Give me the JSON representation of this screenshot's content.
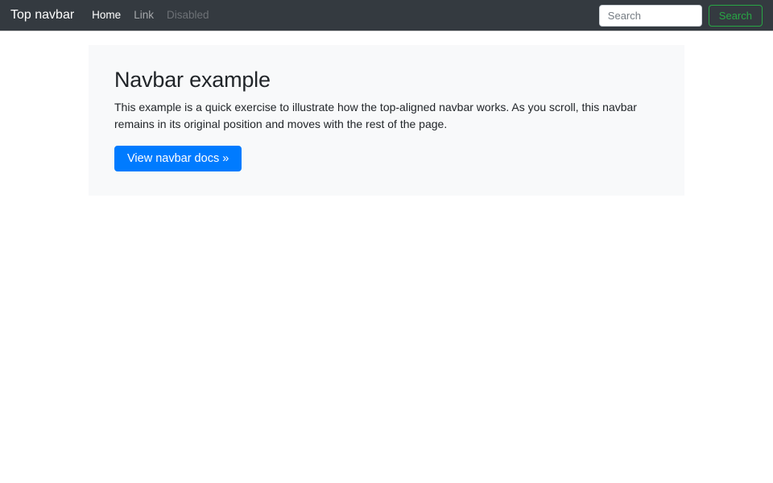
{
  "navbar": {
    "brand": "Top navbar",
    "links": [
      {
        "label": "Home",
        "state": "active"
      },
      {
        "label": "Link",
        "state": "normal"
      },
      {
        "label": "Disabled",
        "state": "disabled"
      }
    ],
    "search": {
      "placeholder": "Search",
      "button_label": "Search"
    }
  },
  "jumbotron": {
    "title": "Navbar example",
    "description": "This example is a quick exercise to illustrate how the top-aligned navbar works. As you scroll, this navbar remains in its original position and moves with the rest of the page.",
    "cta_label": "View navbar docs »"
  },
  "colors": {
    "navbar_bg": "#343a40",
    "primary": "#007bff",
    "success_outline": "#28a745",
    "jumbotron_bg": "#f8f9fa",
    "text": "#212529"
  }
}
